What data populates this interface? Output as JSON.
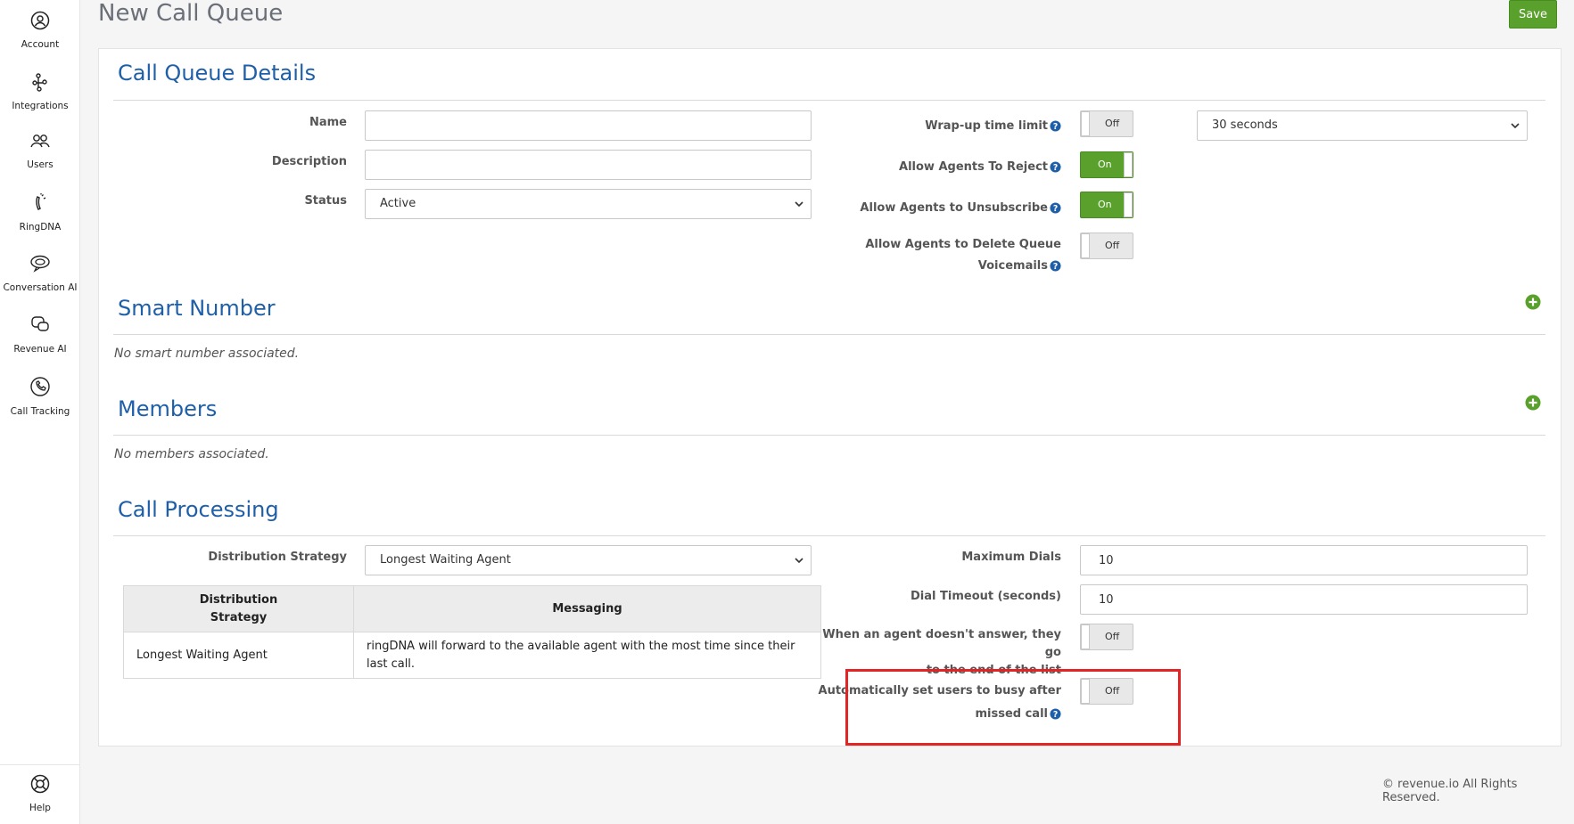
{
  "sidebar": {
    "items": [
      {
        "label": "Account",
        "icon": "account-icon"
      },
      {
        "label": "Integrations",
        "icon": "integrations-icon"
      },
      {
        "label": "Users",
        "icon": "users-icon"
      },
      {
        "label": "RingDNA",
        "icon": "ringdna-icon"
      },
      {
        "label": "Conversation AI",
        "icon": "conversation-ai-icon"
      },
      {
        "label": "Revenue AI",
        "icon": "revenue-ai-icon"
      },
      {
        "label": "Call Tracking",
        "icon": "call-tracking-icon"
      }
    ],
    "help_label": "Help"
  },
  "header": {
    "title": "New Call Queue",
    "save_label": "Save"
  },
  "details": {
    "title": "Call Queue Details",
    "name_label": "Name",
    "name_value": "",
    "description_label": "Description",
    "description_value": "",
    "status_label": "Status",
    "status_value": "Active",
    "wrapup_label": "Wrap-up time limit",
    "wrapup_toggle": "Off",
    "wrapup_select": "30 seconds",
    "reject_label": "Allow Agents To Reject",
    "reject_toggle": "On",
    "unsubscribe_label": "Allow Agents to Unsubscribe",
    "unsubscribe_toggle": "On",
    "delete_vm_label_line1": "Allow Agents to Delete Queue",
    "delete_vm_label_line2": "Voicemails",
    "delete_vm_toggle": "Off"
  },
  "smart_number": {
    "title": "Smart Number",
    "empty_text": "No smart number associated."
  },
  "members": {
    "title": "Members",
    "empty_text": "No members associated."
  },
  "processing": {
    "title": "Call Processing",
    "strategy_label": "Distribution Strategy",
    "strategy_value": "Longest Waiting Agent",
    "table": {
      "headers": [
        "Distribution Strategy",
        "Messaging"
      ],
      "header_0_line1": "Distribution",
      "header_0_line2": "Strategy",
      "rows": [
        {
          "strategy": "Longest Waiting Agent",
          "messaging": "ringDNA will forward to the available agent with the most time since their last call."
        }
      ]
    },
    "max_dials_label": "Maximum Dials",
    "max_dials_value": "10",
    "dial_timeout_label": "Dial Timeout (seconds)",
    "dial_timeout_value": "10",
    "no_answer_label_line1": "When an agent doesn't answer, they go",
    "no_answer_label_line2": "to the end of the list",
    "no_answer_toggle": "Off",
    "auto_busy_label_line1": "Automatically set users to busy after",
    "auto_busy_label_line2": "missed call",
    "auto_busy_toggle": "Off"
  },
  "footer": {
    "copyright": "© revenue.io All Rights Reserved."
  },
  "colors": {
    "accent_blue": "#1f5fa8",
    "save_green": "#5aa02c",
    "highlight_red": "#e32424"
  }
}
